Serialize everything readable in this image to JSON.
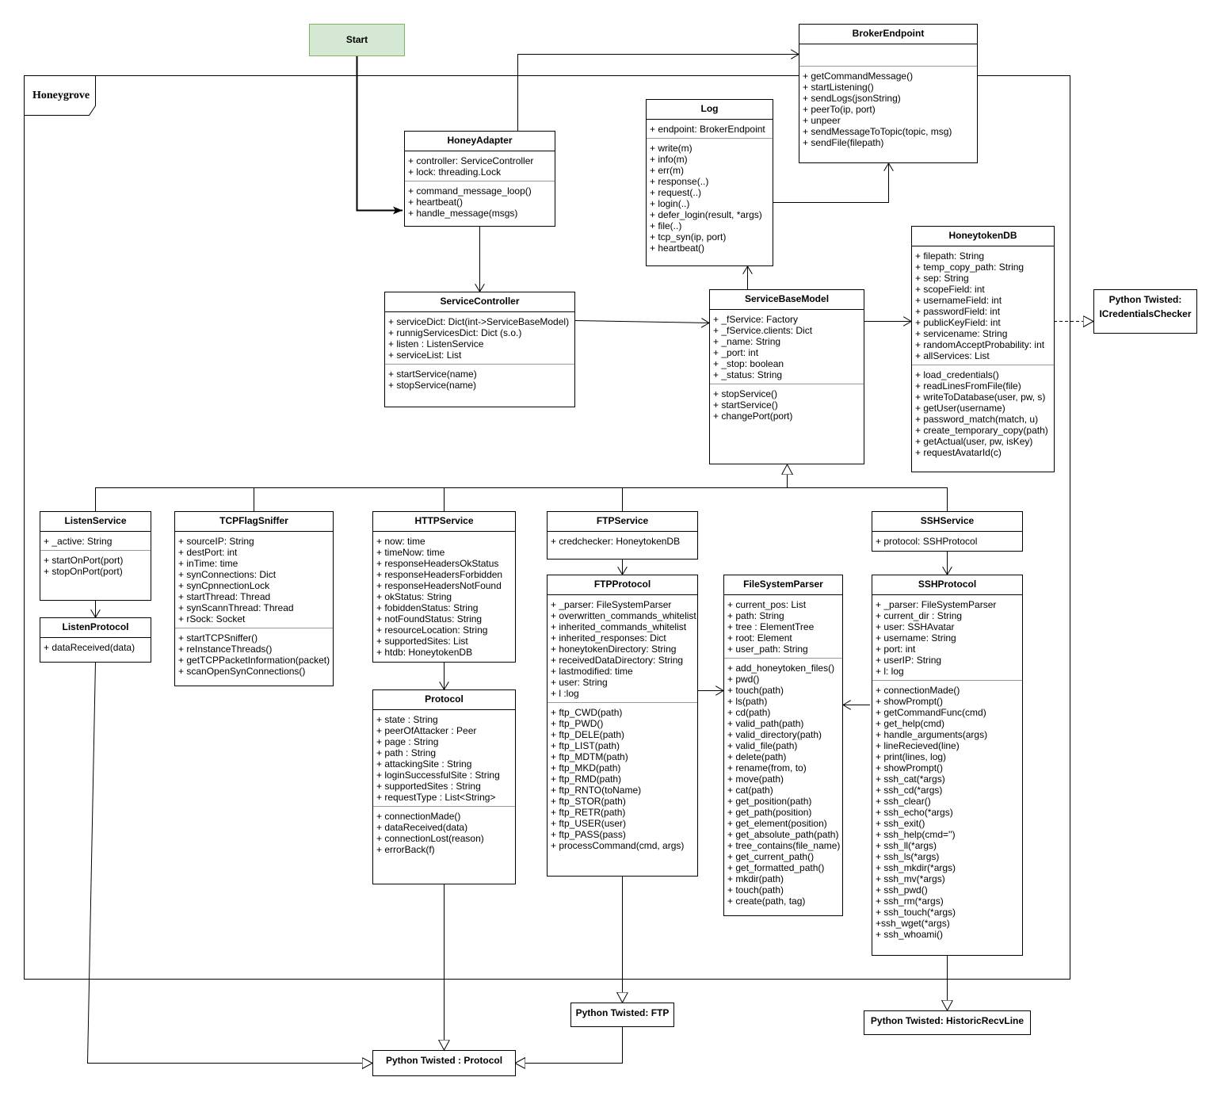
{
  "frame": {
    "label": "Honeygrove"
  },
  "start": {
    "label": "Start"
  },
  "external": {
    "icredentials": "Python Twisted: ICredentialsChecker",
    "ftp": "Python Twisted: FTP",
    "historic": "Python Twisted: HistoricRecvLine",
    "protocol": "Python Twisted : Protocol"
  },
  "classes": {
    "broker": {
      "name": "BrokerEndpoint",
      "attributes": [],
      "methods": [
        "+ getCommandMessage()",
        "+ startListening()",
        "+ sendLogs(jsonString)",
        "+ peerTo(ip, port)",
        "+ unpeer",
        "+ sendMessageToTopic(topic, msg)",
        "+ sendFile(filepath)"
      ]
    },
    "honeyadapter": {
      "name": "HoneyAdapter",
      "attributes": [
        "+ controller: ServiceController",
        "+ lock: threading.Lock"
      ],
      "methods": [
        "+ command_message_loop()",
        "+ heartbeat()",
        "+ handle_message(msgs)"
      ]
    },
    "log": {
      "name": "Log",
      "attributes": [
        "+ endpoint: BrokerEndpoint"
      ],
      "methods": [
        "+ write(m)",
        "+ info(m)",
        "+ err(m)",
        "+ response(..)",
        "+ request(..)",
        "+ login(..)",
        "+ defer_login(result, *args)",
        "+ file(..)",
        "+ tcp_syn(ip, port)",
        "+ heartbeat()"
      ]
    },
    "honeytokendb": {
      "name": "HoneytokenDB",
      "attributes": [
        "+ filepath: String",
        "+ temp_copy_path: String",
        "+ sep: String",
        "+ scopeField: int",
        "+ usernameField: int",
        "+ passwordField: int",
        "+ publicKeyField: int",
        "+ servicename: String",
        "+ randomAcceptProbability: int",
        "+ allServices: List"
      ],
      "methods": [
        "+ load_credentials()",
        "+ readLinesFromFile(file)",
        "+ writeToDatabase(user, pw, s)",
        "+ getUser(username)",
        "+ password_match(match, u)",
        "+ create_temporary_copy(path)",
        "+ getActual(user, pw, isKey)",
        "+ requestAvatarId(c)"
      ]
    },
    "servicecontroller": {
      "name": "ServiceController",
      "attributes": [
        "+ serviceDict: Dict(int->ServiceBaseModel)",
        "+ runnigServicesDict: Dict (s.o.)",
        "+ listen : ListenService",
        "+ serviceList: List"
      ],
      "methods": [
        "+ startService(name)",
        "+ stopService(name)"
      ]
    },
    "servicebasemodel": {
      "name": "ServiceBaseModel",
      "attributes": [
        "+ _fService: Factory",
        "+ _fService.clients: Dict",
        "+ _name: String",
        "+ _port: int",
        "+ _stop: boolean",
        "+ _status: String"
      ],
      "methods": [
        "+ stopService()",
        "+ startService()",
        "+ changePort(port)"
      ]
    },
    "listenservice": {
      "name": "ListenService",
      "attributes": [
        "+ _active: String"
      ],
      "methods": [
        "+ startOnPort(port)",
        "+ stopOnPort(port)"
      ]
    },
    "listenprotocol": {
      "name": "ListenProtocol",
      "attributes": [
        "+ dataReceived(data)"
      ]
    },
    "tcpflagsniffer": {
      "name": "TCPFlagSniffer",
      "attributes": [
        "+ sourceIP: String",
        "+ destPort: int",
        "+ inTime: time",
        "+ synConnections: Dict",
        "+ synCpnnectionLock",
        "+ startThread: Thread",
        "+ synScannThread: Thread",
        "+ rSock: Socket"
      ],
      "methods": [
        "+ startTCPSniffer()",
        "+ reInstanceThreads()",
        "+ getTCPPacketInformation(packet)",
        "+ scanOpenSynConnections()"
      ]
    },
    "httpservice": {
      "name": "HTTPService",
      "attributes": [
        "+ now: time",
        "+ timeNow: time",
        "+ responseHeadersOkStatus",
        "+ responseHeadersForbidden",
        "+ responseHeadersNotFound",
        "+ okStatus: String",
        "+ fobiddenStatus: String",
        "+ notFoundStatus: String",
        "+ resourceLocation: String",
        "+ supportedSites: List",
        "+ htdb: HoneytokenDB"
      ]
    },
    "protocol": {
      "name": "Protocol",
      "attributes": [
        "+ state : String",
        "+ peerOfAttacker : Peer",
        "+ page : String",
        "+ path : String",
        "+ attackingSite : String",
        "+ loginSuccessfulSite : String",
        "+ supportedSites : String",
        "+ requestType : List<String>"
      ],
      "methods": [
        "+ connectionMade()",
        "+ dataReceived(data)",
        "+ connectionLost(reason)",
        "+ errorBack(f)"
      ]
    },
    "ftpservice": {
      "name": "FTPService",
      "attributes": [
        "+ credchecker: HoneytokenDB"
      ]
    },
    "ftpprotocol": {
      "name": "FTPProtocol",
      "attributes": [
        "+ _parser: FileSystemParser",
        "+ overwritten_commands_whitelist",
        "+ inherited_commands_whitelist",
        "+ inherited_responses: Dict",
        "+ honeytokenDirectory: String",
        "+ receivedDataDirectory: String",
        "+ lastmodified: time",
        "+ user: String",
        "+ l :log"
      ],
      "methods": [
        "+ ftp_CWD(path)",
        "+ ftp_PWD()",
        "+ ftp_DELE(path)",
        "+ ftp_LIST(path)",
        "+ ftp_MDTM(path)",
        "+ ftp_MKD(path)",
        "+ ftp_RMD(path)",
        "+ ftp_RNTO(toName)",
        "+ ftp_STOR(path)",
        "+ ftp_RETR(path)",
        "+ ftp_USER(user)",
        "+ ftp_PASS(pass)",
        "+ processCommand(cmd, args)"
      ]
    },
    "filesystemparser": {
      "name": "FileSystemParser",
      "attributes": [
        "+ current_pos: List",
        "+ path: String",
        "+ tree : ElementTree",
        "+ root: Element",
        "+ user_path: String"
      ],
      "methods": [
        "+ add_honeytoken_files()",
        "+ pwd()",
        "+ touch(path)",
        "+ ls(path)",
        "+ cd(path)",
        "+ valid_path(path)",
        "+ valid_directory(path)",
        "+ valid_file(path)",
        "+ delete(path)",
        "+ rename(from, to)",
        "+ move(path)",
        "+ cat(path)",
        "+ get_position(path)",
        "+ get_path(position)",
        "+ get_element(position)",
        "+ get_absolute_path(path)",
        "+ tree_contains(file_name)",
        "+ get_current_path()",
        "+ get_formatted_path()",
        "+ mkdir(path)",
        "+ touch(path)",
        "+ create(path, tag)"
      ]
    },
    "sshservice": {
      "name": "SSHService",
      "attributes": [
        "+ protocol: SSHProtocol"
      ]
    },
    "sshprotocol": {
      "name": "SSHProtocol",
      "attributes": [
        "+ _parser: FileSystemParser",
        "+ current_dir : String",
        "+ user: SSHAvatar",
        "+ username: String",
        "+ port: int",
        "+ userIP: String",
        "+ l: log"
      ],
      "methods": [
        "+ connectionMade()",
        "+ showPrompt()",
        "+ getCommandFunc(cmd)",
        "+ get_help(cmd)",
        "+ handle_arguments(args)",
        "+ lineRecieved(line)",
        "+ print(lines, log)",
        "+ showPrompt()",
        "+ ssh_cat(*args)",
        "+ ssh_cd(*args)",
        "+ ssh_clear()",
        "+ ssh_echo(*args)",
        "+ ssh_exit()",
        "+ ssh_help(cmd='')",
        "+ ssh_ll(*args)",
        "+ ssh_ls(*args)",
        "+ ssh_mkdir(*args)",
        "+ ssh_mv(*args)",
        "+ ssh_pwd()",
        "+ ssh_rm(*args)",
        "+ ssh_touch(*args)",
        "+ssh_wget(*args)",
        "+ ssh_whoami()"
      ]
    }
  },
  "colors": {
    "start_fill": "#d5e8d4",
    "start_border": "#82b366",
    "line": "#000000"
  }
}
